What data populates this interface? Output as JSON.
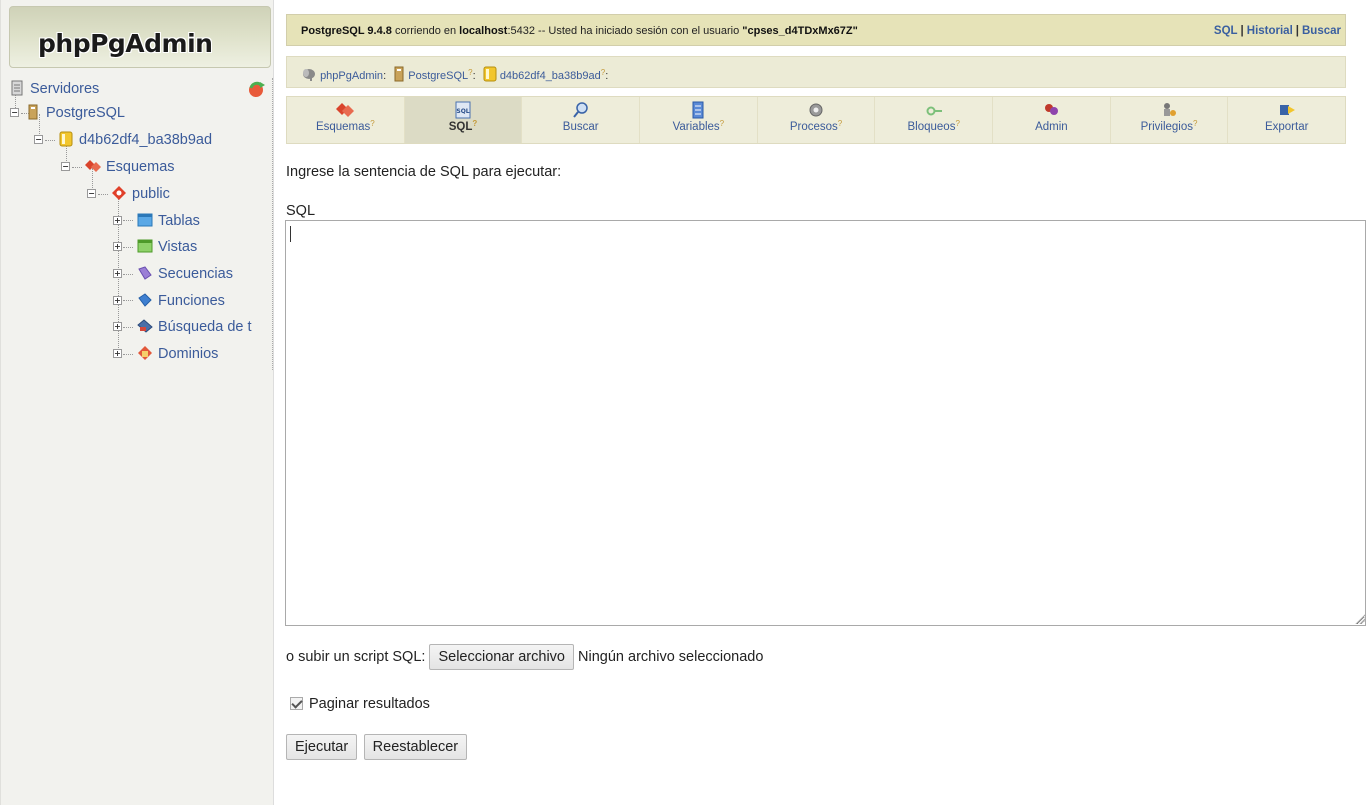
{
  "app": {
    "logo_text": "phpPgAdmin"
  },
  "tree": {
    "servers": "Servidores",
    "server": "PostgreSQL",
    "database": "d4b62df4_ba38b9ad",
    "schemas": "Esquemas",
    "schema": "public",
    "children": [
      "Tablas",
      "Vistas",
      "Secuencias",
      "Funciones",
      "Búsqueda de t",
      "Dominios"
    ]
  },
  "topbar": {
    "product": "PostgreSQL 9.4.8",
    "running_on": " corriendo en ",
    "host": "localhost",
    "port": ":5432 -- Usted ha iniciado sesión con el usuario ",
    "user": "\"cpses_d4TDxMx67Z\"",
    "links": [
      "SQL",
      "Historial",
      "Buscar"
    ],
    "separator": "|"
  },
  "breadcrumb": {
    "items": [
      "phpPgAdmin",
      "PostgreSQL",
      "d4b62df4_ba38b9ad"
    ],
    "sup": "?",
    "colon": ":"
  },
  "tabs": [
    {
      "label": "Esquemas",
      "icon": "schemas-icon",
      "help": "?"
    },
    {
      "label": "SQL",
      "icon": "sql-icon",
      "help": "?",
      "active": true
    },
    {
      "label": "Buscar",
      "icon": "search-icon",
      "help": ""
    },
    {
      "label": "Variables",
      "icon": "variables-icon",
      "help": "?"
    },
    {
      "label": "Procesos",
      "icon": "processes-icon",
      "help": "?"
    },
    {
      "label": "Bloqueos",
      "icon": "locks-icon",
      "help": "?"
    },
    {
      "label": "Admin",
      "icon": "admin-icon",
      "help": ""
    },
    {
      "label": "Privilegios",
      "icon": "privileges-icon",
      "help": "?"
    },
    {
      "label": "Exportar",
      "icon": "export-icon",
      "help": ""
    }
  ],
  "main": {
    "prompt": "Ingrese la sentencia de SQL para ejecutar:",
    "sql_label": "SQL",
    "sql_value": "",
    "upload_label": "o subir un script SQL:",
    "file_button": "Seleccionar archivo",
    "file_status": "Ningún archivo seleccionado",
    "paginate_label": "Paginar resultados",
    "paginate_checked": true,
    "execute_button": "Ejecutar",
    "reset_button": "Reestablecer"
  }
}
